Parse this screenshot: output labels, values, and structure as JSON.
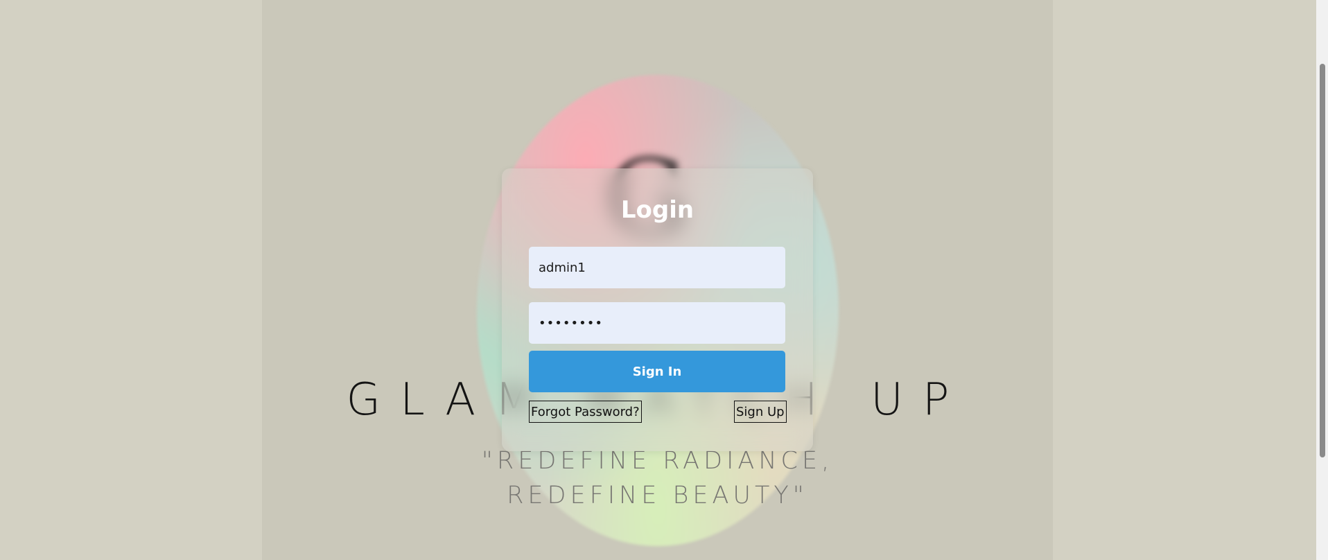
{
  "hero": {
    "logo_letter": "G",
    "brand_name": "GLAM MATCH UP",
    "tagline_line1": "\"REDEFINE RADIANCE,",
    "tagline_line2": "REDEFINE BEAUTY\""
  },
  "login": {
    "title": "Login",
    "username_value": "admin1",
    "password_value": "••••••••",
    "sign_in_label": "Sign In",
    "forgot_label": "Forgot Password?",
    "sign_up_label": "Sign Up"
  },
  "colors": {
    "page_bg": "#d3d1c3",
    "hero_bg": "#cac8ba",
    "button_blue": "#3498db",
    "input_bg": "#e8eefa"
  }
}
